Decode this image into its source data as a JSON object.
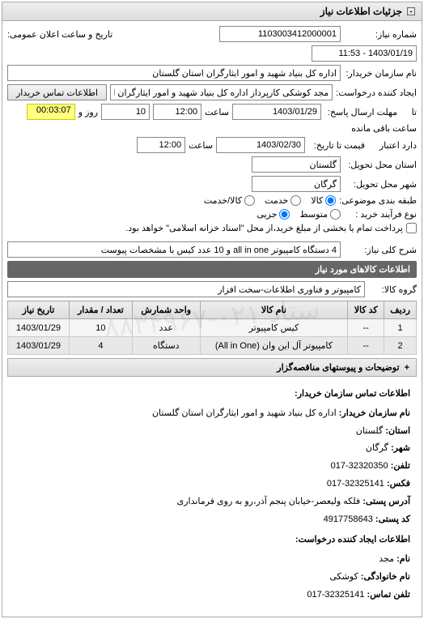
{
  "panel_title": "جزئیات اطلاعات نیاز",
  "form": {
    "need_no_label": "شماره نیاز:",
    "need_no": "1103003412000001",
    "announce_label": "تاریخ و ساعت اعلان عمومی:",
    "announce_value": "1403/01/19 - 11:53",
    "buyer_label": "نام سازمان خریدار:",
    "buyer_value": "اداره کل بنیاد شهید و امور ایثارگران استان گلستان",
    "requester_label": "ایجاد کننده درخواست:",
    "requester_value": "مجد کوشکی کارپرداز اداره کل بنیاد شهید و امور ایثارگران استان گلستان",
    "contact_btn": "اطلاعات تماس خریدار",
    "deadline_label_to": "تا",
    "deadline_label": "مهلت ارسال پاسخ:",
    "deadline_date": "1403/01/29",
    "time_label": "ساعت",
    "deadline_time": "12:00",
    "days_value": "10",
    "days_label": "روز و",
    "countdown": "00:03:07",
    "countdown_label": "ساعت باقی مانده",
    "accept_to_label": "دارد اعتبار",
    "price_until_label": "قیمت تا تاریخ:",
    "price_until_date": "1403/02/30",
    "price_until_time": "12:00",
    "province_label": "استان محل تحویل:",
    "province_value": "گلستان",
    "city_label": "شهر محل تحویل:",
    "city_value": "گرگان",
    "class_label": "طبقه بندی موضوعی:",
    "class_options": {
      "goods": "کالا",
      "service": "خدمت",
      "goods_service": "کالا/خدمت"
    },
    "process_label": "نوع فرآیند خرید :",
    "process_options": {
      "medium": "متوسط",
      "small": "جزیی"
    },
    "process_note": "پرداخت تمام یا بخشی از مبلغ خرید،از محل \"اسناد خزانه اسلامی\" خواهد بود.",
    "desc_label": "شرح کلی نیاز:",
    "desc_value": "4 دستگاه کامپیوتر all in one و 10 عدد کیس با مشخصات پیوست"
  },
  "goods_section_title": "اطلاعات کالاهای مورد نیاز",
  "group_label": "گروه کالا:",
  "group_value": "کامپیوتر و فناوری اطلاعات-سخت افزار",
  "table": {
    "headers": {
      "row": "ردیف",
      "code": "کد کالا",
      "name": "نام کالا",
      "unit": "واحد شمارش",
      "qty": "تعداد / مقدار",
      "date": "تاریخ نیاز"
    },
    "rows": [
      {
        "row": "1",
        "code": "--",
        "name": "کیس کامپیوتر",
        "unit": "عدد",
        "qty": "10",
        "date": "1403/01/29"
      },
      {
        "row": "2",
        "code": "--",
        "name": "کامپیوتر آل این وان (All in One)",
        "unit": "دستگاه",
        "qty": "4",
        "date": "1403/01/29"
      }
    ]
  },
  "collapsed_section": "توضیحات و پیوستهای مناقصه‌گزار",
  "contact": {
    "title": "اطلاعات تماس سازمان خریدار:",
    "org_label": "نام سازمان خریدار:",
    "org_value": "اداره کل بنیاد شهید و امور ایثارگران استان گلستان",
    "province_label": "استان:",
    "province_value": "گلستان",
    "city_label": "شهر:",
    "city_value": "گرگان",
    "phone_label": "تلفن:",
    "phone_value": "32320350-017",
    "fax_label": "فکس:",
    "fax_value": "32325141-017",
    "address_label": "آدرس پستی:",
    "address_value": "فلکه ولیعصر-خیابان پنجم آذر،رو به روی فرمانداری",
    "postal_label": "کد پستی:",
    "postal_value": "4917758643",
    "req_section": "اطلاعات ایجاد کننده درخواست:",
    "name_label": "نام:",
    "name_value": "مجد",
    "family_label": "نام خانوادگی:",
    "family_value": "کوشکی",
    "cphone_label": "تلفن تماس:",
    "cphone_value": "32325141-017"
  },
  "watermark": "ستاد ۰۲۱-۸۸۳۴۹۶۷"
}
